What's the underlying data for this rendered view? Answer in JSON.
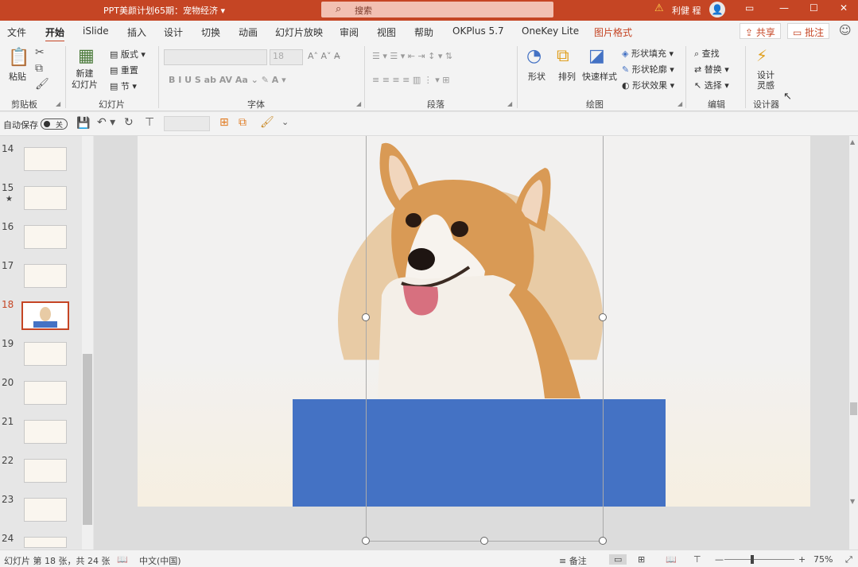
{
  "window": {
    "title": "PPT美颜计划65期：宠物经济",
    "title_caret": "▾",
    "search_placeholder": "搜索",
    "user": "利健 程",
    "buttons": [
      "▭",
      "—",
      "☐",
      "✕"
    ]
  },
  "tabs": [
    "文件",
    "开始",
    "iSlide",
    "插入",
    "设计",
    "切换",
    "动画",
    "幻灯片放映",
    "审阅",
    "视图",
    "帮助",
    "OKPlus 5.7",
    "OneKey Lite",
    "图片格式"
  ],
  "active_tab": "开始",
  "share_label": "共享",
  "comment_label": "批注",
  "ribbon": {
    "clipboard": {
      "paste": "粘贴",
      "label": "剪贴板"
    },
    "slides": {
      "new_slide": "新建\n幻灯片",
      "layout": "版式",
      "reset": "重置",
      "section": "节",
      "label": "幻灯片"
    },
    "font": {
      "label": "字体",
      "size_placeholder": "18"
    },
    "paragraph": {
      "label": "段落"
    },
    "drawing": {
      "shape": "形状",
      "arrange": "排列",
      "quick_styles": "快速样式",
      "fill": "形状填充",
      "outline": "形状轮廓",
      "effects": "形状效果",
      "label": "绘图"
    },
    "editing": {
      "find": "查找",
      "replace": "替换",
      "select": "选择",
      "label": "编辑"
    },
    "designer": {
      "ideas": "设计\n灵感",
      "label": "设计器"
    }
  },
  "qat": {
    "autosave": "自动保存",
    "toggle": "关"
  },
  "thumbnails": [
    {
      "num": "14",
      "star": ""
    },
    {
      "num": "15",
      "star": "★"
    },
    {
      "num": "16",
      "star": ""
    },
    {
      "num": "17",
      "star": ""
    },
    {
      "num": "18",
      "star": ""
    },
    {
      "num": "19",
      "star": ""
    },
    {
      "num": "20",
      "star": ""
    },
    {
      "num": "21",
      "star": ""
    },
    {
      "num": "22",
      "star": ""
    },
    {
      "num": "23",
      "star": ""
    },
    {
      "num": "24",
      "star": ""
    }
  ],
  "selected_slide": "18",
  "status": {
    "slide_info": "幻灯片 第 18 张，共 24 张",
    "language": "中文(中国)",
    "notes": "备注",
    "zoom": "75%",
    "zoom_fraction": 0.75
  },
  "colors": {
    "accent": "#c54524",
    "blue_box": "#4472c4",
    "circle": "#e8cba5"
  }
}
